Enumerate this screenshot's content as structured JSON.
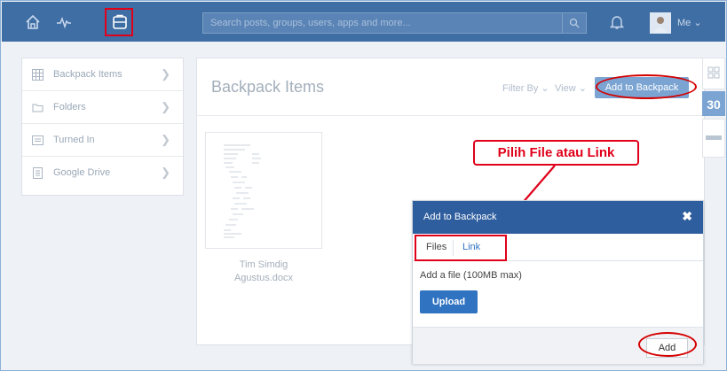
{
  "search": {
    "placeholder": "Search posts, groups, users, apps and more..."
  },
  "user": {
    "label": "Me"
  },
  "sidebar": {
    "items": [
      {
        "label": "Backpack Items",
        "icon": "grid-icon"
      },
      {
        "label": "Folders",
        "icon": "folder-icon"
      },
      {
        "label": "Turned In",
        "icon": "tray-icon"
      },
      {
        "label": "Google Drive",
        "icon": "drive-doc-icon"
      }
    ]
  },
  "main": {
    "title": "Backpack Items",
    "filter_label": "Filter By",
    "view_label": "View",
    "add_button": "Add to Backpack",
    "file": {
      "name_line1": "Tim Simdig",
      "name_line2": "Agustus.docx"
    }
  },
  "widgets": {
    "calendar_number": "30"
  },
  "modal": {
    "title": "Add to Backpack",
    "close": "✖",
    "tabs": [
      "Files",
      "Link"
    ],
    "description": "Add a file (100MB max)",
    "upload_label": "Upload",
    "add_label": "Add"
  },
  "annotation": {
    "text": "Pilih File atau Link"
  },
  "colors": {
    "topbar": "#3f6ea5",
    "modal_header": "#2f5e9e",
    "upload": "#2f73c1",
    "annotation_red": "#e0001a"
  }
}
